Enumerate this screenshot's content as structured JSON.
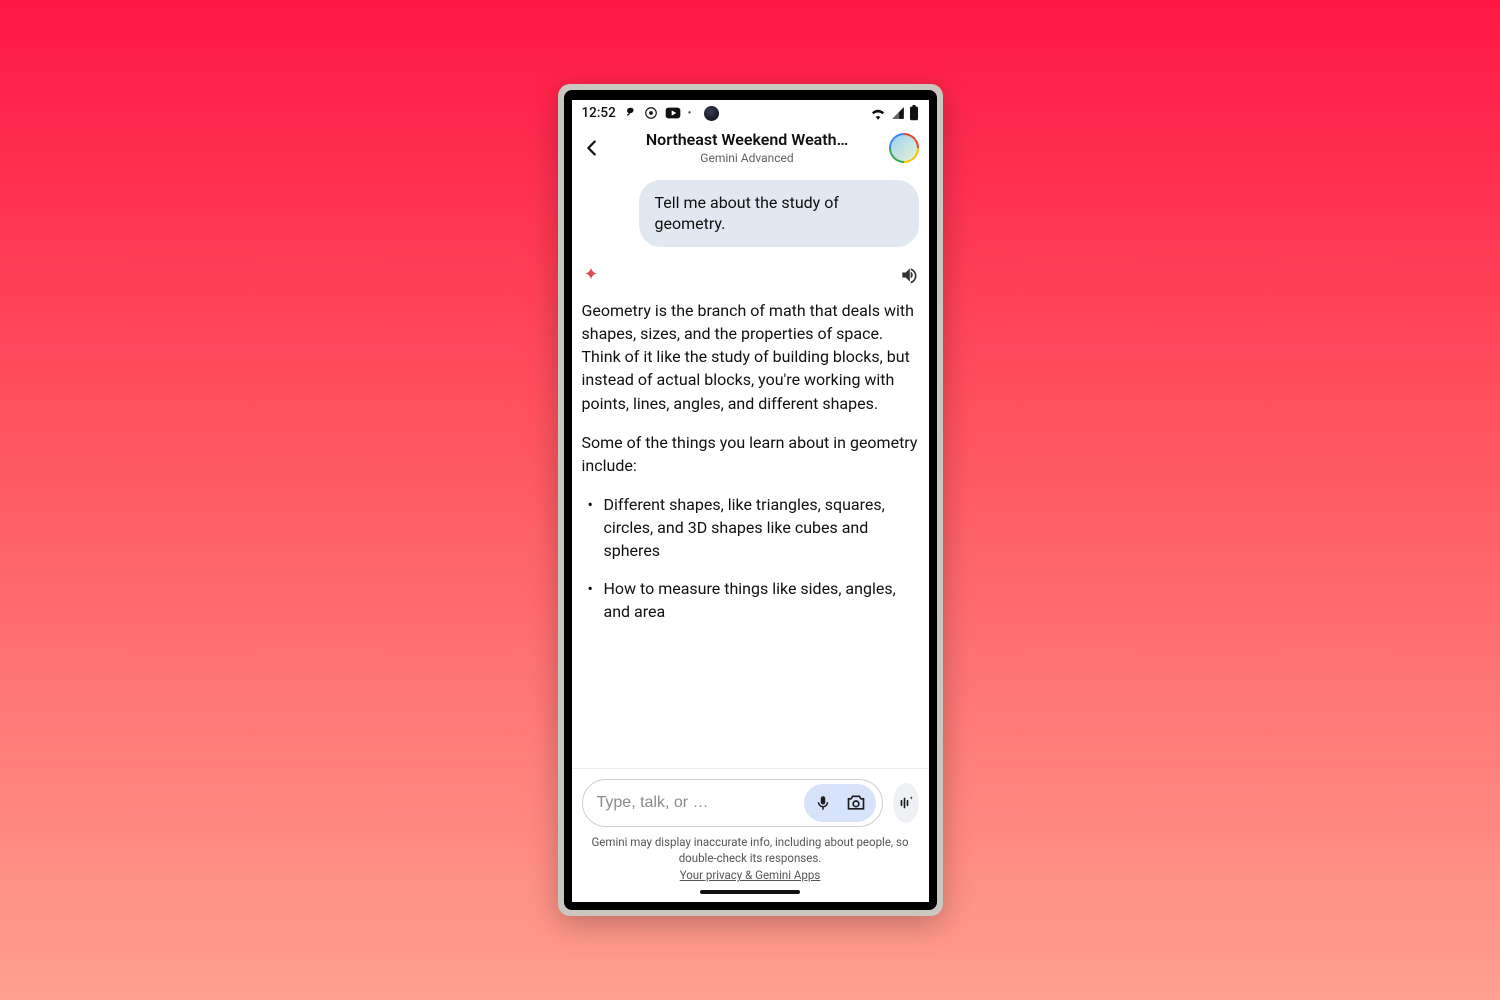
{
  "status": {
    "time": "12:52"
  },
  "header": {
    "title": "Northeast Weekend Weath…",
    "subtitle": "Gemini Advanced"
  },
  "conversation": {
    "user_message": "Tell me about the study of geometry.",
    "assistant": {
      "p1": "Geometry is the branch of math that deals with shapes, sizes, and the properties of space. Think of it like the study of building blocks, but instead of actual blocks, you're working with points, lines, angles, and different shapes.",
      "p2": "Some of the things you learn about in geometry include:",
      "bullets": [
        "Different shapes, like triangles, squares, circles, and 3D shapes like cubes and spheres",
        "How to measure things like sides, angles, and area"
      ]
    }
  },
  "input": {
    "placeholder": "Type, talk, or …"
  },
  "footer": {
    "disclaimer": "Gemini may display inaccurate info, including about people, so double-check its responses.",
    "privacy_link": "Your privacy & Gemini Apps"
  }
}
